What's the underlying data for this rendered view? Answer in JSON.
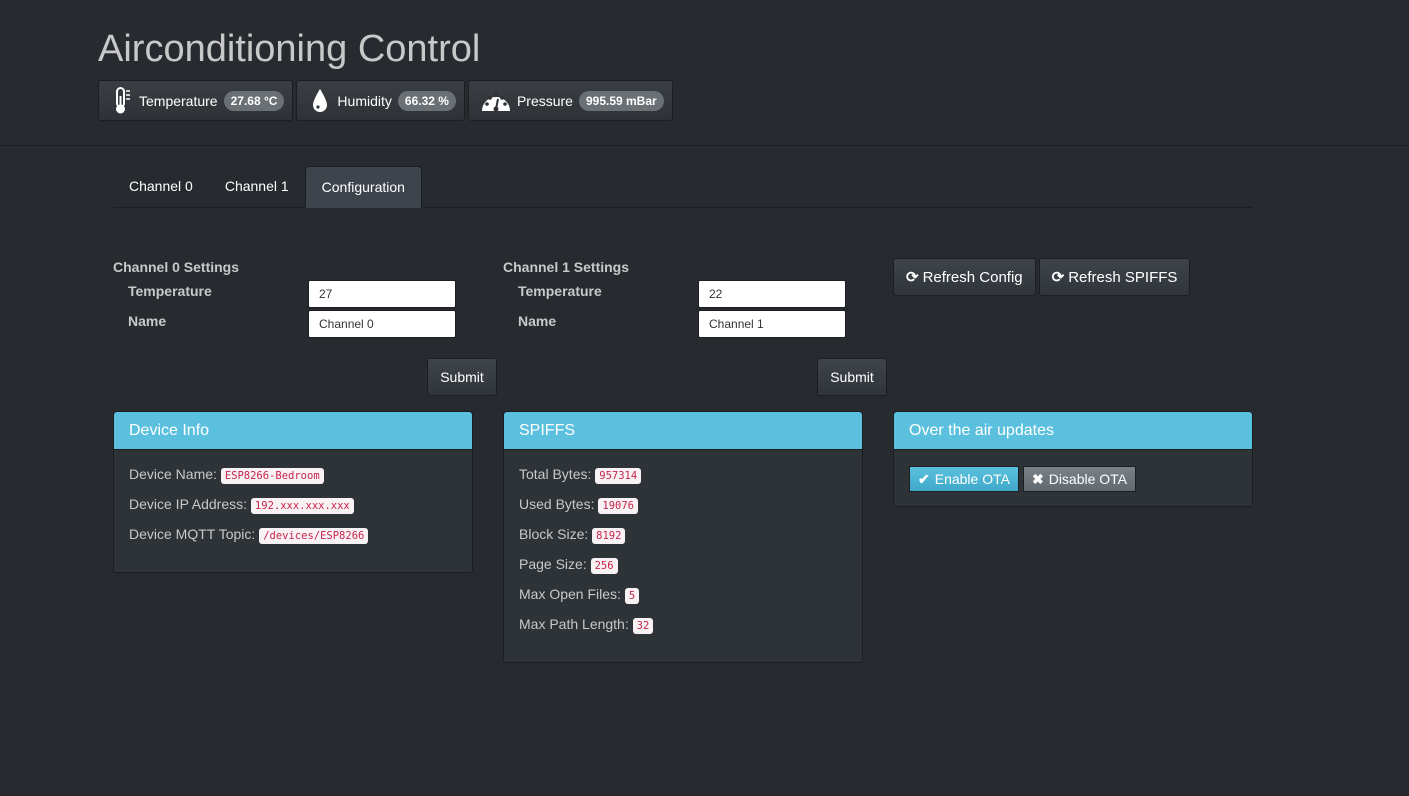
{
  "header": {
    "title": "Airconditioning Control",
    "sensors": [
      {
        "icon": "thermometer-icon",
        "label": "Temperature",
        "value": "27.68 °C"
      },
      {
        "icon": "water-drop-icon",
        "label": "Humidity",
        "value": "66.32 %"
      },
      {
        "icon": "gauge-icon",
        "label": "Pressure",
        "value": "995.59 mBar"
      }
    ]
  },
  "tabs": [
    {
      "label": "Channel 0",
      "active": false
    },
    {
      "label": "Channel 1",
      "active": false
    },
    {
      "label": "Configuration",
      "active": true
    }
  ],
  "channels": [
    {
      "title": "Channel 0 Settings",
      "temperature_label": "Temperature",
      "temperature_value": "27",
      "name_label": "Name",
      "name_value": "Channel 0",
      "submit_label": "Submit"
    },
    {
      "title": "Channel 1 Settings",
      "temperature_label": "Temperature",
      "temperature_value": "22",
      "name_label": "Name",
      "name_value": "Channel 1",
      "submit_label": "Submit"
    }
  ],
  "actions": {
    "refresh_config": "Refresh Config",
    "refresh_spiffs": "Refresh SPIFFS",
    "refresh_glyph": "⟳"
  },
  "device_info": {
    "title": "Device Info",
    "items": [
      {
        "label": "Device Name:",
        "value": "ESP8266-Bedroom"
      },
      {
        "label": "Device IP Address:",
        "value": "192.xxx.xxx.xxx"
      },
      {
        "label": "Device MQTT Topic:",
        "value": "/devices/ESP8266"
      }
    ]
  },
  "spiffs": {
    "title": "SPIFFS",
    "items": [
      {
        "label": "Total Bytes:",
        "value": "957314"
      },
      {
        "label": "Used Bytes:",
        "value": "19076"
      },
      {
        "label": "Block Size:",
        "value": "8192"
      },
      {
        "label": "Page Size:",
        "value": "256"
      },
      {
        "label": "Max Open Files:",
        "value": "5"
      },
      {
        "label": "Max Path Length:",
        "value": "32"
      }
    ]
  },
  "ota": {
    "title": "Over the air updates",
    "enable_label": "Enable OTA",
    "disable_label": "Disable OTA",
    "enable_glyph": "✔",
    "disable_glyph": "✖"
  },
  "colors": {
    "background": "#272b30",
    "panel_header": "#5bc0de",
    "code_text": "#c7254e"
  }
}
